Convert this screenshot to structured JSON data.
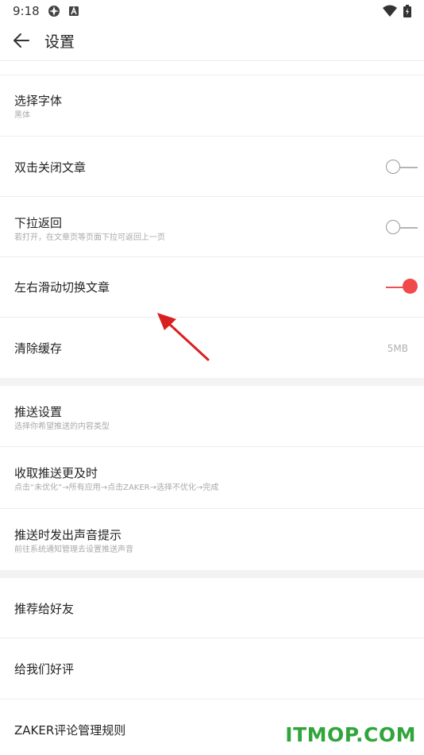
{
  "status_bar": {
    "time": "9:18"
  },
  "header": {
    "title": "设置"
  },
  "section1": {
    "font": {
      "label": "选择字体",
      "sub": "黑体"
    },
    "double_tap": {
      "label": "双击关闭文章",
      "toggle": "off"
    },
    "pull_back": {
      "label": "下拉返回",
      "sub": "若打开，在文章页等页面下拉可返回上一页",
      "toggle": "off"
    },
    "swipe": {
      "label": "左右滑动切换文章",
      "toggle": "on"
    },
    "cache": {
      "label": "清除缓存",
      "value": "5MB"
    }
  },
  "section2": {
    "push_settings": {
      "label": "推送设置",
      "sub": "选择你希望推送的内容类型"
    },
    "push_timely": {
      "label": "收取推送更及时",
      "sub": "点击“未优化”→所有应用→点击ZAKER→选择不优化→完成"
    },
    "push_sound": {
      "label": "推送时发出声音提示",
      "sub": "前往系统通知管理去设置推送声音"
    }
  },
  "section3": {
    "recommend": {
      "label": "推荐给好友"
    },
    "rate": {
      "label": "给我们好评"
    },
    "rules": {
      "label": "ZAKER评论管理规则"
    }
  },
  "watermark": {
    "text": "ITMOP.COM"
  },
  "colors": {
    "accent": "#f04a4a",
    "watermark": "#2fa53a",
    "divider": "#ececec",
    "gap": "#f3f3f3"
  }
}
